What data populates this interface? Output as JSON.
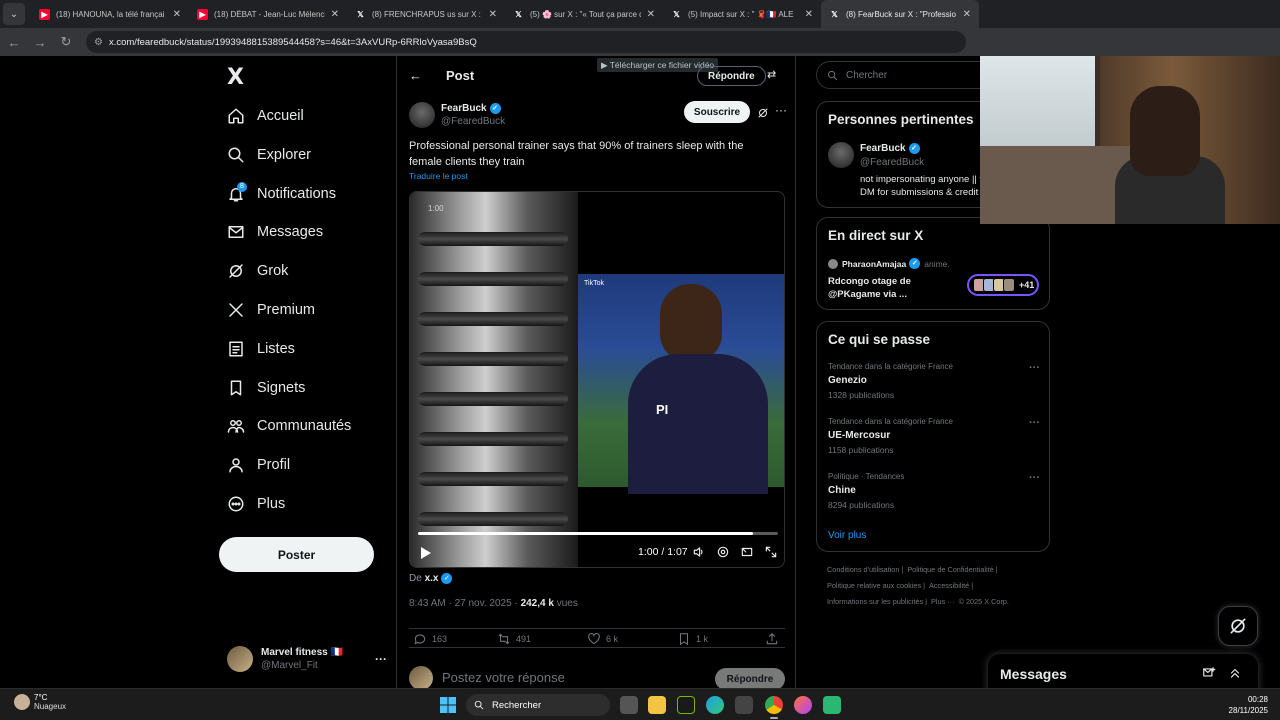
{
  "browser": {
    "tabs": [
      {
        "label": "(18) HANOUNA, la télé françai",
        "favicon": "youtube-icon"
      },
      {
        "label": "(18) DÉBAT - Jean-Luc Mélench",
        "favicon": "youtube-icon"
      },
      {
        "label": "(8) FRENCHRAPUS us sur X : \" 🧣",
        "favicon": "x-icon"
      },
      {
        "label": "(5) 🌸 sur X : \"« Tout ça parce q",
        "favicon": "x-icon"
      },
      {
        "label": "(5) Impact sur X : \" 🧣🇫🇷 ALE",
        "favicon": "x-icon"
      },
      {
        "label": "(8) FearBuck sur X : \"Professio",
        "favicon": "x-icon",
        "active": true
      }
    ],
    "url": "x.com/fearedbuck/status/1993948815389544458?s=46&t=3AxVURp-6RRloVyasa9BsQ"
  },
  "nav": {
    "logo": "X",
    "items": [
      {
        "label": "Accueil",
        "icon": "home-icon"
      },
      {
        "label": "Explorer",
        "icon": "search-icon"
      },
      {
        "label": "Notifications",
        "icon": "bell-icon",
        "badge": "8"
      },
      {
        "label": "Messages",
        "icon": "envelope-icon"
      },
      {
        "label": "Grok",
        "icon": "grok-icon"
      },
      {
        "label": "Premium",
        "icon": "x-icon"
      },
      {
        "label": "Listes",
        "icon": "list-icon"
      },
      {
        "label": "Signets",
        "icon": "bookmark-icon"
      },
      {
        "label": "Communautés",
        "icon": "communities-icon"
      },
      {
        "label": "Profil",
        "icon": "user-icon"
      },
      {
        "label": "Plus",
        "icon": "more-circle-icon"
      }
    ],
    "post_button": "Poster",
    "account": {
      "name": "Marvel fitness 🇫🇷",
      "handle": "@Marvel_Fit"
    }
  },
  "post": {
    "header_title": "Post",
    "reply_top": "Répondre",
    "download_bar": "▶ Télécharger ce fichier vidéo",
    "author": {
      "name": "FearBuck",
      "handle": "@FearedBuck"
    },
    "subscribe_label": "Souscrire",
    "text": "Professional personal trainer says that 90% of trainers sleep with the female clients they train",
    "translate": "Traduire le post",
    "video": {
      "tiktok_label": "TikTok",
      "time": "1:00 / 1:07",
      "progress": 0.93,
      "overlay_time": "1:00",
      "shirt_logo": "PI"
    },
    "from_prefix": "De",
    "from_user": "x.x",
    "meta_time": "8:43 AM · 27 nov. 2025 · ",
    "views_count": "242,4 k",
    "views_label": " vues",
    "actions": {
      "replies": "163",
      "reposts": "491",
      "likes": "6 k",
      "bookmarks": "1 k"
    },
    "reply_placeholder": "Postez votre réponse",
    "reply_button": "Répondre"
  },
  "right": {
    "search_placeholder": "Chercher",
    "relevant": {
      "title": "Personnes pertinentes",
      "name": "FearBuck",
      "handle": "@FearedBuck",
      "bio": "not impersonating anyone || turn notis on || DM for submissions & credit ||"
    },
    "live": {
      "title": "En direct sur X",
      "host": "PharaonAmajaa",
      "role": "anime.",
      "space_title": "Rdcongo otage de @PKagame via ...",
      "count": "+41"
    },
    "trending": {
      "title": "Ce qui se passe",
      "items": [
        {
          "category": "Tendance dans la catégorie France",
          "topic": "Genezio",
          "count": "1328 publications"
        },
        {
          "category": "Tendance dans la catégorie France",
          "topic": "UE-Mercosur",
          "count": "1158 publications"
        },
        {
          "category": "Politique · Tendances",
          "topic": "Chine",
          "count": "8294 publications"
        }
      ],
      "see_more": "Voir plus"
    },
    "footer": [
      "Conditions d'utilisation |",
      "Politique de Confidentialité |",
      "Politique relative aux cookies |",
      "Accessibilité |",
      "Informations sur les publicités |",
      "Plus ···",
      "© 2025 X Corp."
    ]
  },
  "messages_dock": {
    "title": "Messages"
  },
  "taskbar": {
    "temperature": "7°C",
    "weather": "Nuageux",
    "search": "Rechercher",
    "time": "00:28",
    "date": "28/11/2025"
  },
  "colors": {
    "accent": "#1d9bf0",
    "background": "#000000",
    "border": "#2f3336",
    "muted": "#71767b"
  }
}
